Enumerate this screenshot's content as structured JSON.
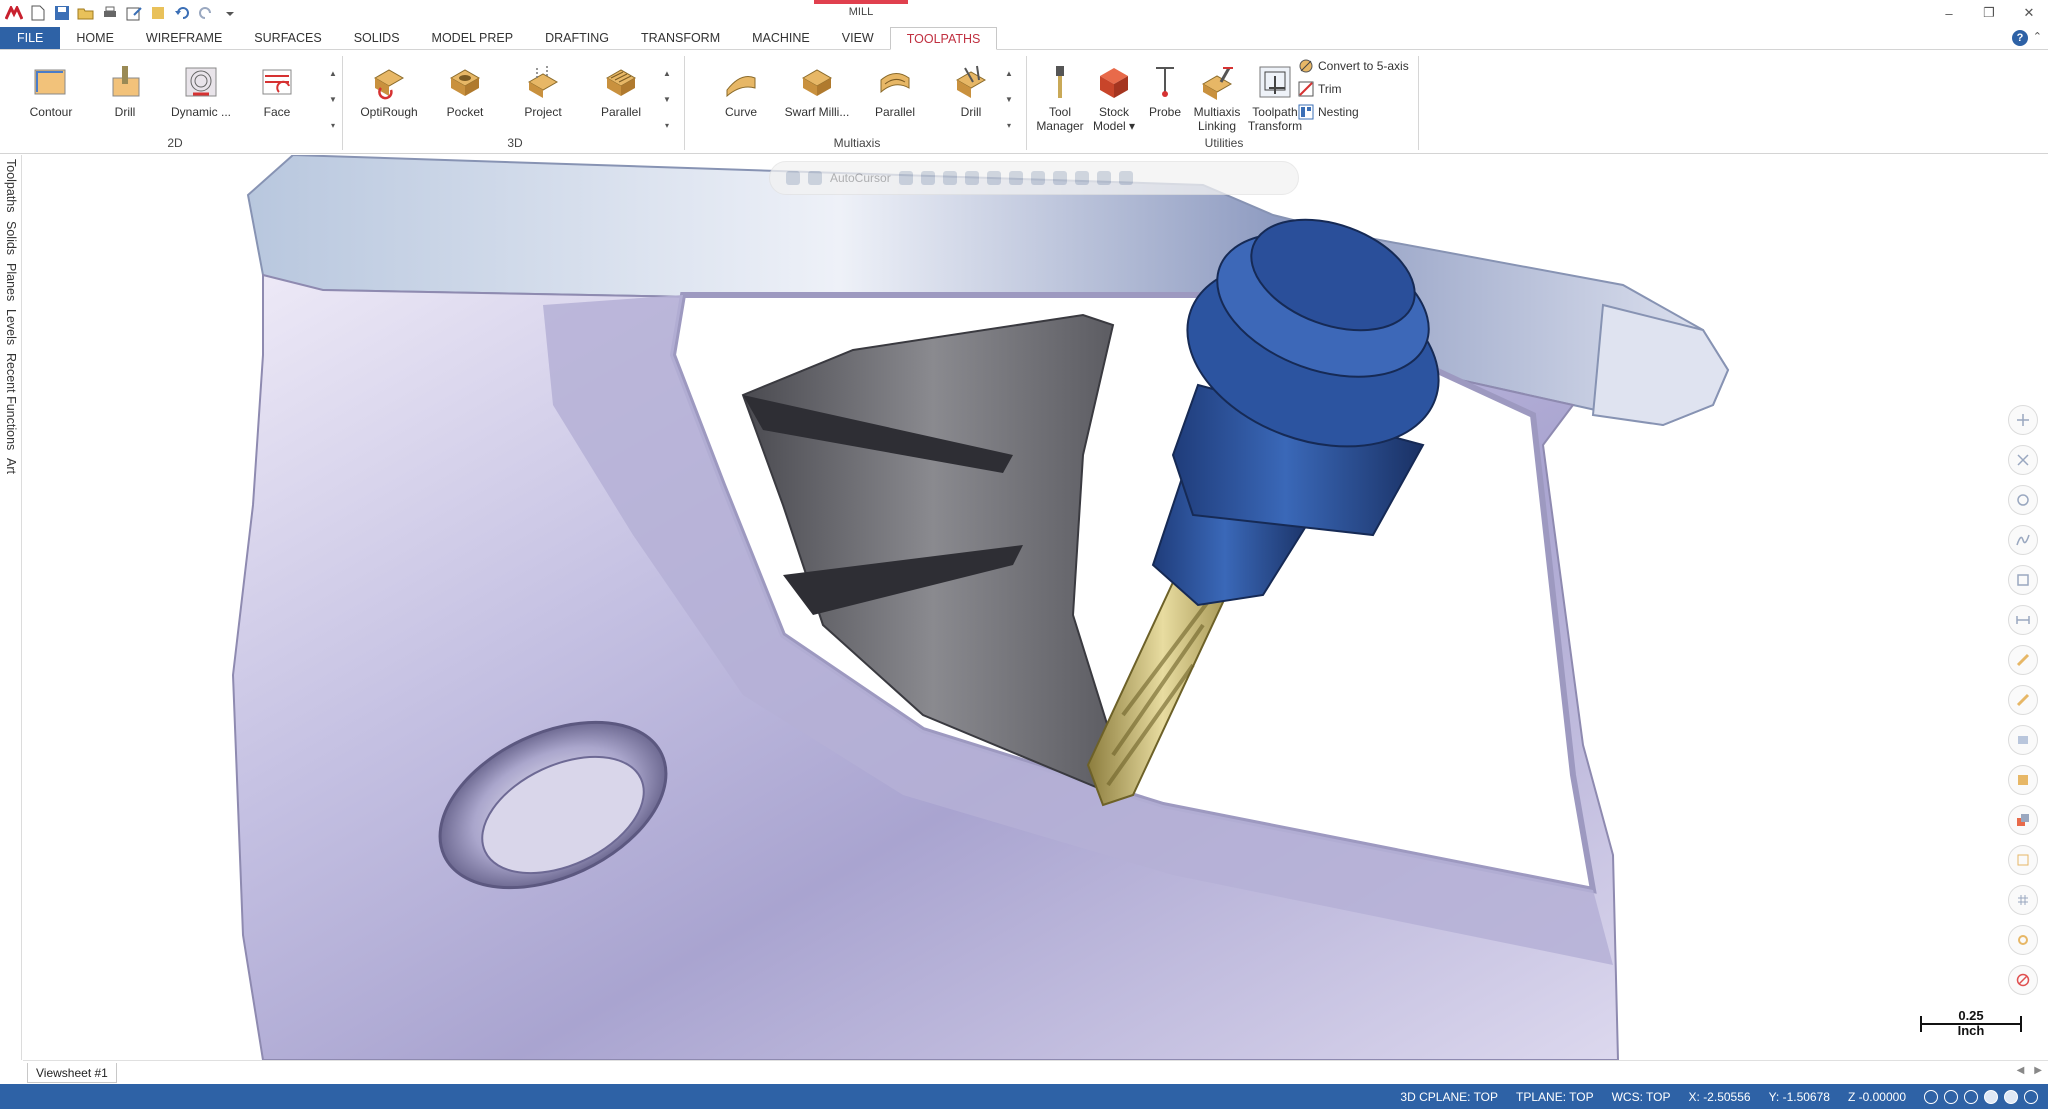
{
  "title_bar": {
    "context_tab_label": "MILL",
    "quick_access_icons": [
      "app-logo-icon",
      "new-icon",
      "save-icon",
      "open-icon",
      "print-icon",
      "save-as-icon",
      "recent-icon",
      "undo-icon",
      "redo-icon",
      "customize-icon"
    ],
    "window_controls": [
      "minimize-icon",
      "restore-icon",
      "close-icon"
    ]
  },
  "ribbon_tabs": [
    "FILE",
    "HOME",
    "WIREFRAME",
    "SURFACES",
    "SOLIDS",
    "MODEL PREP",
    "DRAFTING",
    "TRANSFORM",
    "MACHINE",
    "VIEW",
    "TOOLPATHS"
  ],
  "active_tab": "TOOLPATHS",
  "ribbon": {
    "groups": {
      "g2d": {
        "label": "2D",
        "buttons": [
          "Contour",
          "Drill",
          "Dynamic ...",
          "Face"
        ]
      },
      "g3d": {
        "label": "3D",
        "buttons": [
          "OptiRough",
          "Pocket",
          "Project",
          "Parallel"
        ]
      },
      "gmulti": {
        "label": "Multiaxis",
        "buttons": [
          "Curve",
          "Swarf Milli...",
          "Parallel",
          "Drill"
        ]
      },
      "gutil": {
        "label": "Utilities",
        "buttons": [
          {
            "line1": "Tool",
            "line2": "Manager"
          },
          {
            "line1": "Stock",
            "line2": "Model ▾"
          },
          {
            "line1": "Probe",
            "line2": ""
          },
          {
            "line1": "Multiaxis",
            "line2": "Linking"
          },
          {
            "line1": "Toolpath",
            "line2": "Transform"
          }
        ],
        "small_buttons": [
          "Convert to 5-axis",
          "Trim",
          "Nesting"
        ]
      }
    }
  },
  "side_tabs": [
    "Toolpaths",
    "Solids",
    "Planes",
    "Levels",
    "Recent Functions",
    "Art"
  ],
  "viewport": {
    "floating_toolbar_label": "AutoCursor",
    "scale": {
      "value": "0.25",
      "unit": "Inch"
    }
  },
  "viewsheet_tab": "Viewsheet #1",
  "status_bar": {
    "cplane": "3D CPLANE: TOP",
    "tplane": "TPLANE: TOP",
    "wcs": "WCS: TOP",
    "x": "X:  -2.50556",
    "y": "Y:  -1.50678",
    "z": "Z  -0.00000"
  },
  "colors": {
    "file_tab": "#2e62a6",
    "active_tab_text": "#c03040",
    "status_bar": "#2e62a6",
    "part": "#c7c3e4",
    "holder": "#2a4f9a",
    "cutter": "#c9b86a"
  }
}
